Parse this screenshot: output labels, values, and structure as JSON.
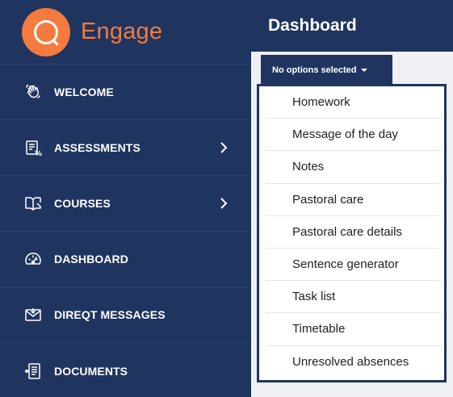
{
  "brand": {
    "name": "Engage",
    "logo_icon": "engage-logo-icon",
    "accent": "#f47a3e"
  },
  "sidebar": {
    "background": "#1f3560",
    "items": [
      {
        "label": "WELCOME",
        "icon": "waving-hand-icon",
        "has_chevron": false
      },
      {
        "label": "ASSESSMENTS",
        "icon": "assessment-icon",
        "has_chevron": true
      },
      {
        "label": "COURSES",
        "icon": "book-icon",
        "has_chevron": true
      },
      {
        "label": "DASHBOARD",
        "icon": "speedometer-icon",
        "has_chevron": false
      },
      {
        "label": "DIREQT MESSAGES",
        "icon": "envelope-icon",
        "has_chevron": false
      },
      {
        "label": "DOCUMENTS",
        "icon": "document-icon",
        "has_chevron": false
      }
    ]
  },
  "main": {
    "title": "Dashboard",
    "select": {
      "label": "No options selected",
      "options": [
        "Homework",
        "Message of the day",
        "Notes",
        "Pastoral care",
        "Pastoral care details",
        "Sentence generator",
        "Task list",
        "Timetable",
        "Unresolved absences"
      ]
    }
  }
}
